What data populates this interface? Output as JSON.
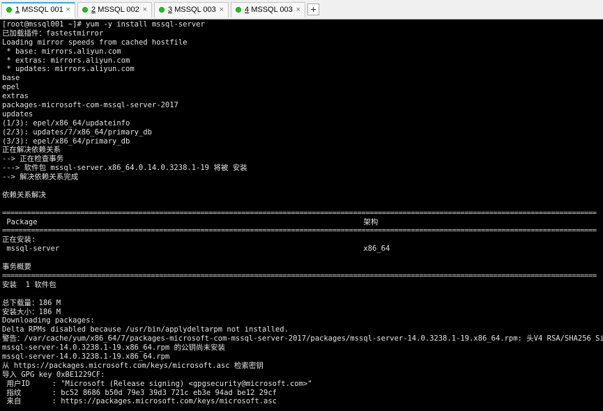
{
  "tabs": [
    {
      "index": "1",
      "name": "MSSQL 001",
      "active": true
    },
    {
      "index": "2",
      "name": "MSSQL 002",
      "active": false
    },
    {
      "index": "3",
      "name": "MSSQL 003",
      "active": false
    },
    {
      "index": "4",
      "name": "MSSQL 003",
      "active": false
    }
  ],
  "tab_close_glyph": "×",
  "add_tab_glyph": "+",
  "terminal": {
    "lines": [
      "[root@mssql001 ~]# yum -y install mssql-server",
      "已加载插件：fastestmirror",
      "Loading mirror speeds from cached hostfile",
      " * base: mirrors.aliyun.com",
      " * extras: mirrors.aliyun.com",
      " * updates: mirrors.aliyun.com",
      "base",
      "epel",
      "extras",
      "packages-microsoft-com-mssql-server-2017",
      "updates",
      "(1/3): epel/x86_64/updateinfo",
      "(2/3): updates/7/x86_64/primary_db",
      "(3/3): epel/x86_64/primary_db",
      "正在解决依赖关系",
      "--> 正在检查事务",
      "---> 软件包 mssql-server.x86_64.0.14.0.3238.1-19 将被 安装",
      "--> 解决依赖关系完成",
      "",
      "依赖关系解决",
      "",
      "================================================================================================================================================",
      " Package                                                                          架构",
      "================================================================================================================================================",
      "正在安装:",
      " mssql-server                                                                     x86_64",
      "",
      "事务概要",
      "================================================================================================================================================",
      "安装  1 软件包",
      "",
      "总下载量：186 M",
      "安装大小：186 M",
      "Downloading packages:",
      "Delta RPMs disabled because /usr/bin/applydeltarpm not installed.",
      "警告：/var/cache/yum/x86_64/7/packages-microsoft-com-mssql-server-2017/packages/mssql-server-14.0.3238.1-19.x86_64.rpm: 头V4 RSA/SHA256 Signat",
      "mssql-server-14.0.3238.1-19.x86_64.rpm 的公钥尚未安装",
      "mssql-server-14.0.3238.1-19.x86_64.rpm",
      "从 https://packages.microsoft.com/keys/microsoft.asc 检索密钥",
      "导入 GPG key 0xBE1229CF:",
      " 用户ID     : \"Microsoft (Release signing) <gpgsecurity@microsoft.com>\"",
      " 指纹       : bc52 8686 b50d 79e3 39d3 721c eb3e 94ad be12 29cf",
      " 来自       : https://packages.microsoft.com/keys/microsoft.asc"
    ]
  }
}
